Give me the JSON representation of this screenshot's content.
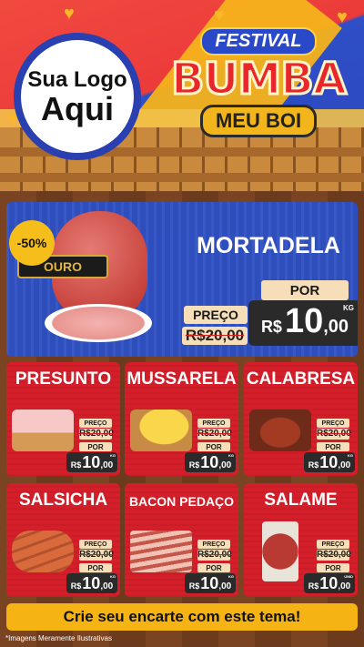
{
  "header": {
    "logo_line1": "Sua Logo",
    "logo_line2": "Aqui",
    "festival": "FESTIVAL",
    "bumba": "BUMBA",
    "meu_boi": "MEU BOI"
  },
  "featured": {
    "badge": "-50%",
    "product_label": "OURO",
    "name": "MORTADELA",
    "preco_label": "PREÇO",
    "old_price": "R$20,00",
    "por_label": "POR",
    "currency": "R$",
    "price_int": "10",
    "price_dec": ",00",
    "unit": "KG"
  },
  "products": [
    {
      "name": "PRESUNTO",
      "preco_label": "PREÇO",
      "old_price": "R$20,00",
      "por_label": "POR",
      "currency": "R$",
      "price_int": "10",
      "price_dec": ",00",
      "unit": "KG"
    },
    {
      "name": "MUSSARELA",
      "preco_label": "PREÇO",
      "old_price": "R$20,00",
      "por_label": "POR",
      "currency": "R$",
      "price_int": "10",
      "price_dec": ",00",
      "unit": "KG"
    },
    {
      "name": "CALABRESA",
      "preco_label": "PREÇO",
      "old_price": "R$20,00",
      "por_label": "POR",
      "currency": "R$",
      "price_int": "10",
      "price_dec": ",00",
      "unit": "KG"
    },
    {
      "name": "SALSICHA",
      "preco_label": "PREÇO",
      "old_price": "R$20,00",
      "por_label": "POR",
      "currency": "R$",
      "price_int": "10",
      "price_dec": ",00",
      "unit": "KG"
    },
    {
      "name": "BACON PEDAÇO",
      "preco_label": "PREÇO",
      "old_price": "R$20,00",
      "por_label": "POR",
      "currency": "R$",
      "price_int": "10",
      "price_dec": ",00",
      "unit": "KG"
    },
    {
      "name": "SALAME",
      "preco_label": "PREÇO",
      "old_price": "R$20,00",
      "por_label": "POR",
      "currency": "R$",
      "price_int": "10",
      "price_dec": ",00",
      "unit": "UNID"
    }
  ],
  "cta": "Crie seu encarte com este tema!",
  "footnote": "*Imagens Meramente Ilustrativas",
  "colors": {
    "red": "#d41f2a",
    "blue": "#2f51c3",
    "yellow": "#f6b414",
    "wood": "#6b3a1c"
  }
}
